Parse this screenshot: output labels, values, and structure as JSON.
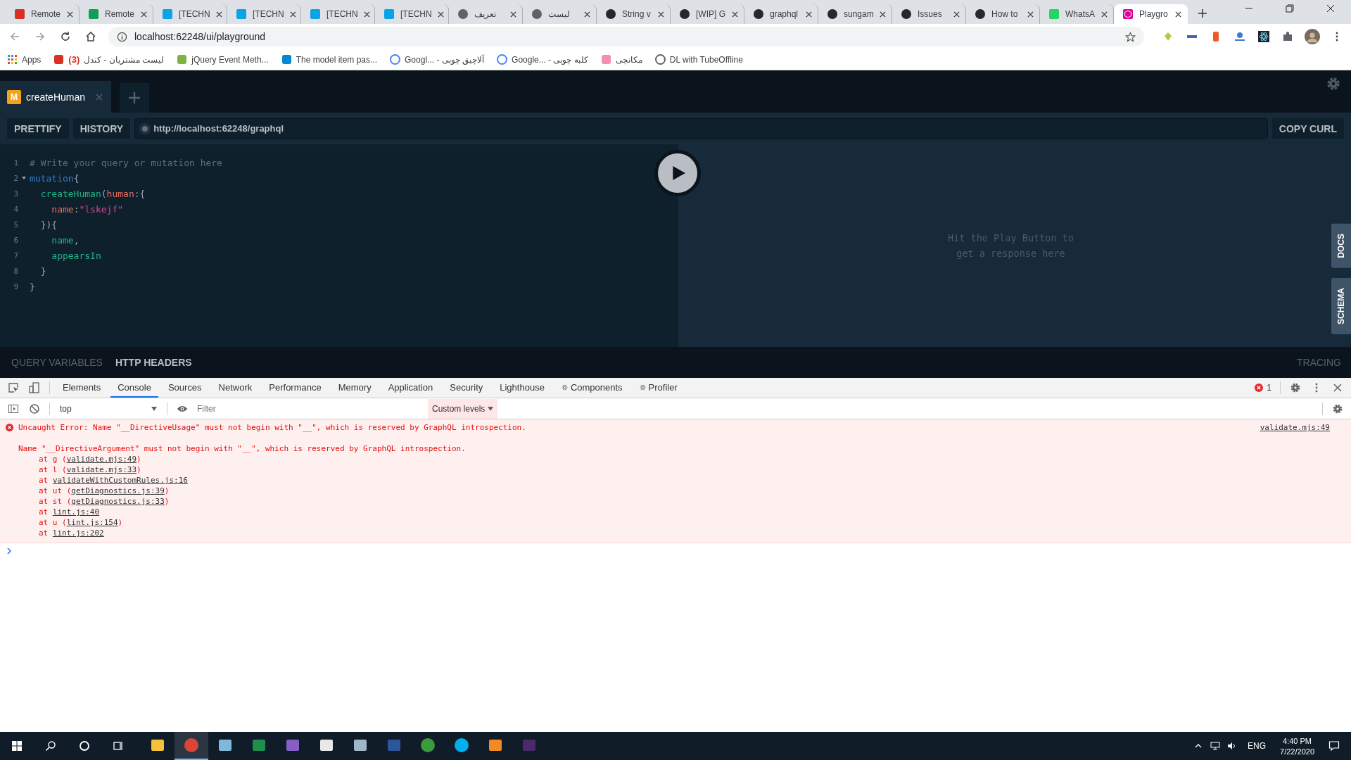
{
  "browser": {
    "tabs": [
      {
        "kind": "gmail",
        "title": "Remote",
        "selected": false
      },
      {
        "kind": "sheets",
        "title": "Remote",
        "selected": false
      },
      {
        "kind": "techn",
        "title": "[TECHN",
        "selected": false
      },
      {
        "kind": "techn",
        "title": "[TECHN",
        "selected": false
      },
      {
        "kind": "techn",
        "title": "[TECHN",
        "selected": false
      },
      {
        "kind": "techn",
        "title": "[TECHN",
        "selected": false
      },
      {
        "kind": "globe",
        "title": "تعریف",
        "selected": false
      },
      {
        "kind": "globe",
        "title": "لیست",
        "selected": false
      },
      {
        "kind": "github",
        "title": "String v",
        "selected": false
      },
      {
        "kind": "github",
        "title": "[WIP] G",
        "selected": false
      },
      {
        "kind": "github",
        "title": "graphql",
        "selected": false
      },
      {
        "kind": "github",
        "title": "sungam",
        "selected": false
      },
      {
        "kind": "github",
        "title": "Issues",
        "selected": false
      },
      {
        "kind": "github",
        "title": "How to",
        "selected": false
      },
      {
        "kind": "whatsapp",
        "title": "WhatsA",
        "selected": false
      },
      {
        "kind": "playground",
        "title": "Playgro",
        "selected": true
      }
    ],
    "address": "localhost:62248/ui/playground",
    "bookmarks": [
      {
        "kind": "apps",
        "label": "Apps"
      },
      {
        "kind": "red",
        "badge": "(3)",
        "label": "لیست مشتریان - کندل"
      },
      {
        "kind": "w3",
        "label": "jQuery Event Meth..."
      },
      {
        "kind": "blue",
        "label": "The model item pas..."
      },
      {
        "kind": "google",
        "label": "Googl... - آلاچیق چوبی"
      },
      {
        "kind": "google",
        "label": "Google... - کلبه چوبی"
      },
      {
        "kind": "pink",
        "label": "مکانچی"
      },
      {
        "kind": "globe",
        "label": "DL with TubeOffline"
      }
    ]
  },
  "playground": {
    "tabs": [
      {
        "badge": "M",
        "title": "createHuman",
        "selected": true
      }
    ],
    "toolbar": {
      "buttons": [
        "PRETTIFY",
        "HISTORY"
      ],
      "endpoint": "http://localhost:62248/graphql",
      "copy": "COPY CURL"
    },
    "editor": {
      "lines": [
        {
          "number": "1",
          "foldable": false,
          "tokens": [
            {
              "kind": "comment",
              "t": "# Write your query or mutation here"
            }
          ]
        },
        {
          "number": "2",
          "foldable": true,
          "tokens": [
            {
              "kind": "keyword",
              "t": "mutation"
            },
            {
              "kind": "punct",
              "t": "{"
            }
          ]
        },
        {
          "number": "3",
          "foldable": false,
          "tokens": [
            {
              "kind": "field",
              "t": "  createHuman"
            },
            {
              "kind": "punct",
              "t": "("
            },
            {
              "kind": "arg",
              "t": "human"
            },
            {
              "kind": "punct",
              "t": ":{"
            }
          ]
        },
        {
          "number": "4",
          "foldable": false,
          "tokens": [
            {
              "kind": "arg",
              "t": "    name"
            },
            {
              "kind": "punct",
              "t": ":"
            },
            {
              "kind": "string",
              "t": "\"lskejf\""
            }
          ]
        },
        {
          "number": "5",
          "foldable": false,
          "tokens": [
            {
              "kind": "punct",
              "t": "  }){"
            }
          ]
        },
        {
          "number": "6",
          "foldable": false,
          "tokens": [
            {
              "kind": "field",
              "t": "    name"
            },
            {
              "kind": "punct",
              "t": ","
            }
          ]
        },
        {
          "number": "7",
          "foldable": false,
          "tokens": [
            {
              "kind": "field",
              "t": "    appearsIn"
            }
          ]
        },
        {
          "number": "8",
          "foldable": false,
          "tokens": [
            {
              "kind": "punct",
              "t": "  }"
            }
          ]
        },
        {
          "number": "9",
          "foldable": false,
          "tokens": [
            {
              "kind": "punct",
              "t": "}"
            }
          ]
        }
      ]
    },
    "response": {
      "hint": [
        "Hit the Play Button to",
        "get a response here"
      ]
    },
    "side_tabs": [
      "DOCS",
      "SCHEMA"
    ],
    "bottom_tabs": [
      {
        "label": "QUERY VARIABLES",
        "selected": false
      },
      {
        "label": "HTTP HEADERS",
        "selected": true
      }
    ],
    "tracing": "TRACING"
  },
  "devtools": {
    "tabs": [
      {
        "label": "Elements",
        "kind": "builtin",
        "selected": false
      },
      {
        "label": "Console",
        "kind": "builtin",
        "selected": true
      },
      {
        "label": "Sources",
        "kind": "builtin",
        "selected": false
      },
      {
        "label": "Network",
        "kind": "builtin",
        "selected": false
      },
      {
        "label": "Performance",
        "kind": "builtin",
        "selected": false
      },
      {
        "label": "Memory",
        "kind": "builtin",
        "selected": false
      },
      {
        "label": "Application",
        "kind": "builtin",
        "selected": false
      },
      {
        "label": "Security",
        "kind": "builtin",
        "selected": false
      },
      {
        "label": "Lighthouse",
        "kind": "builtin",
        "selected": false
      },
      {
        "label": "Components",
        "kind": "react",
        "selected": false
      },
      {
        "label": "Profiler",
        "kind": "react",
        "selected": false
      }
    ],
    "error_count": "1",
    "context": "top",
    "filter_placeholder": "Filter",
    "levels": "Custom levels",
    "error": {
      "headline": "Uncaught Error: Name \"__DirectiveUsage\" must not begin with \"__\", which is reserved by GraphQL introspection.",
      "source": "validate.mjs:49",
      "detail": "Name \"__DirectiveArgument\" must not begin with \"__\", which is reserved by GraphQL introspection.",
      "stack": [
        {
          "before": "at g (",
          "link": "validate.mjs:49",
          "after": ")"
        },
        {
          "before": "at l (",
          "link": "validate.mjs:33",
          "after": ")"
        },
        {
          "before": "at ",
          "link": "validateWithCustomRules.js:16"
        },
        {
          "before": "at ut (",
          "link": "getDiagnostics.js:39",
          "after": ")"
        },
        {
          "before": "at st (",
          "link": "getDiagnostics.js:33",
          "after": ")"
        },
        {
          "before": "at ",
          "link": "lint.js:40"
        },
        {
          "before": "at u (",
          "link": "lint.js:154",
          "after": ")"
        },
        {
          "before": "at ",
          "link": "lint.js:202"
        }
      ]
    }
  },
  "taskbar": {
    "apps": [
      {
        "kind": "folder",
        "active": false
      },
      {
        "kind": "chrome",
        "active": true
      },
      {
        "kind": "notepad",
        "active": false
      },
      {
        "kind": "excel",
        "active": false
      },
      {
        "kind": "vs",
        "active": false
      },
      {
        "kind": "calc",
        "active": false
      },
      {
        "kind": "paint",
        "active": false
      },
      {
        "kind": "word",
        "active": false
      },
      {
        "kind": "edge",
        "active": false
      },
      {
        "kind": "skype",
        "active": false
      },
      {
        "kind": "media",
        "active": false
      },
      {
        "kind": "terminal",
        "active": false
      }
    ],
    "language": "ENG",
    "time": "4:40 PM",
    "date": "7/22/2020"
  }
}
